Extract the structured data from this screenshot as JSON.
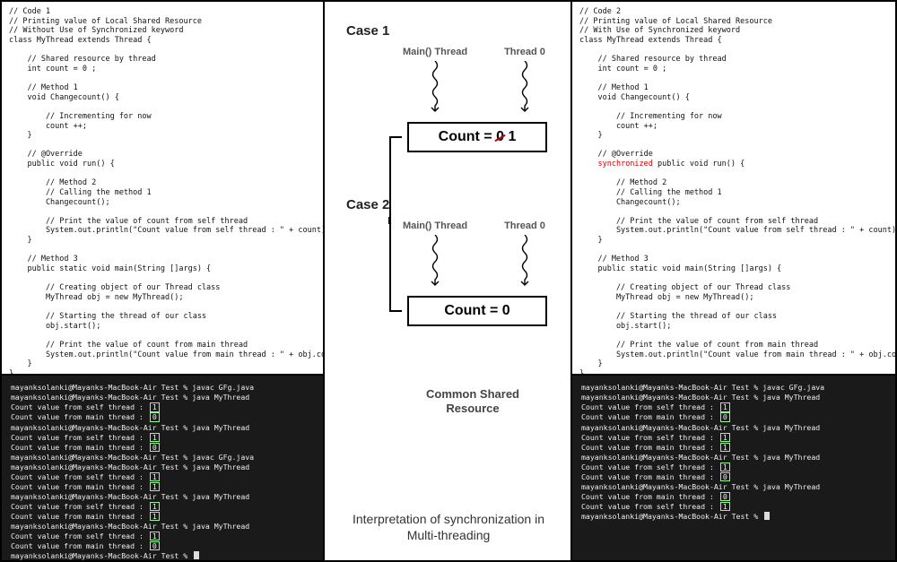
{
  "left": {
    "code": "// Code 1\n// Printing value of Local Shared Resource\n// Without Use of Synchronized keyword\nclass MyThread extends Thread {\n\n    // Shared resource by thread\n    int count = 0 ;\n\n    // Method 1\n    void Changecount() {\n\n        // Incrementing for now\n        count ++;\n    }\n\n    // @Override\n    public void run() {\n\n        // Method 2\n        // Calling the method 1\n        Changecount();\n\n        // Print the value of count from self thread\n        System.out.println(\"Count value from self thread : \" + count);\n    }\n\n    // Method 3\n    public static void main(String []args) {\n\n        // Creating object of our Thread class\n        MyThread obj = new MyThread();\n\n        // Starting the thread of our class\n        obj.start();\n\n        // Print the value of count from main thread\n        System.out.println(\"Count value from main thread : \" + obj.count);\n    }\n}",
    "terminal": {
      "prompt": "mayanksolanki@Mayanks-MacBook-Air Test % ",
      "cmd_compile": "javac GFg.java",
      "cmd_run": "java MyThread",
      "self_line": "Count value from self thread : ",
      "main_line": "Count value from main thread : ",
      "runs": [
        {
          "self": "1",
          "main": "0"
        },
        {
          "self": "1",
          "main": "0"
        },
        {
          "compile": true,
          "self": "1",
          "main": "1"
        },
        {
          "self": "1",
          "main": "1"
        },
        {
          "self": "1",
          "main": "0"
        }
      ]
    }
  },
  "right": {
    "code_pre": "// Code 2\n// Printing value of Local Shared Resource\n// With Use of Synchronized keyword\nclass MyThread extends Thread {\n\n    // Shared resource by thread\n    int count = 0 ;\n\n    // Method 1\n    void Changecount() {\n\n        // Incrementing for now\n        count ++;\n    }\n\n    // @Override\n    ",
    "kw": "synchronized",
    "code_post": " public void run() {\n\n        // Method 2\n        // Calling the method 1\n        Changecount();\n\n        // Print the value of count from self thread\n        System.out.println(\"Count value from self thread : \" + count);\n    }\n\n    // Method 3\n    public static void main(String []args) {\n\n        // Creating object of our Thread class\n        MyThread obj = new MyThread();\n\n        // Starting the thread of our class\n        obj.start();\n\n        // Print the value of count from main thread\n        System.out.println(\"Count value from main thread : \" + obj.count);\n    }\n}",
    "terminal": {
      "prompt": "mayanksolanki@Mayanks-MacBook-Air Test % ",
      "cmd_compile": "javac GFg.java",
      "cmd_run": "java MyThread",
      "self_line": "Count value from self thread : ",
      "main_line": "Count value from main thread : ",
      "runs": [
        {
          "compile": true,
          "self": "1",
          "main": "0"
        },
        {
          "self": "1",
          "main": "1"
        },
        {
          "self": "1",
          "main": "0"
        },
        {
          "main_first": true,
          "main": "0",
          "self": "1"
        }
      ]
    }
  },
  "mid": {
    "case1": "Case 1",
    "case2": "Case 2",
    "main_thread": "Main() Thread",
    "thread0": "Thread 0",
    "count_eq": "Count = ",
    "zero": "0",
    "one": " 1",
    "count0": "Count = 0",
    "common": "Common Shared Resource",
    "interp": "Interpretation of synchronization in Multi-threading"
  }
}
